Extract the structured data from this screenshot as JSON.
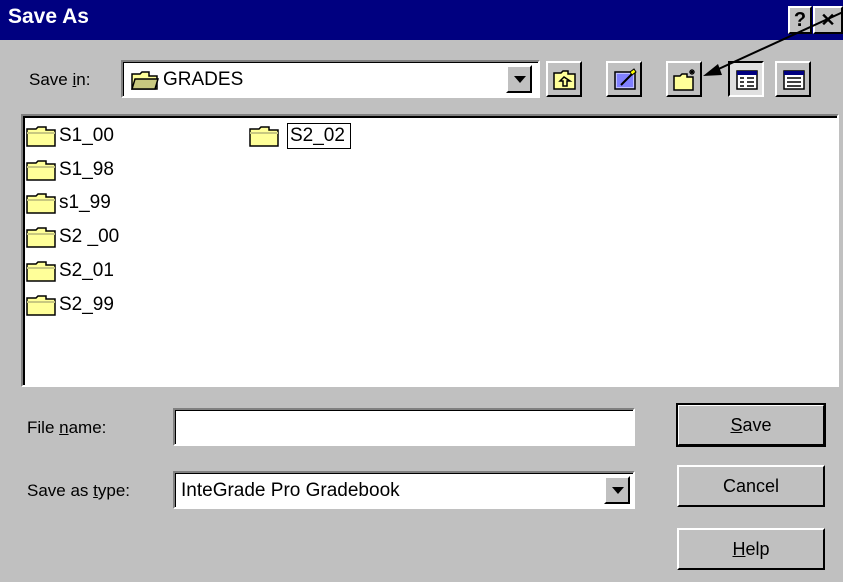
{
  "window": {
    "title": "Save As",
    "help_glyph": "?",
    "close_glyph": "✕"
  },
  "save_in": {
    "label_pre": "Save ",
    "label_underline": "i",
    "label_post": "n:",
    "current_folder": "GRADES"
  },
  "toolbar": {
    "buttons": [
      {
        "icon": "up-one-level-icon"
      },
      {
        "icon": "go-to-favorites-icon"
      },
      {
        "icon": "create-new-folder-icon"
      },
      {
        "icon": "list-view-icon"
      },
      {
        "icon": "details-view-icon"
      }
    ]
  },
  "files": [
    {
      "name": "S1_00"
    },
    {
      "name": "S1_98"
    },
    {
      "name": "s1_99"
    },
    {
      "name": "S2 _00"
    },
    {
      "name": "S2_01"
    },
    {
      "name": "S2_99"
    },
    {
      "name": "S2_02",
      "editing": true
    }
  ],
  "filename": {
    "label_pre": "File ",
    "label_underline": "n",
    "label_post": "ame:",
    "value": ""
  },
  "filetype": {
    "label_pre": "Save as ",
    "label_underline": "t",
    "label_post": "ype:",
    "value": "InteGrade Pro Gradebook"
  },
  "buttons": {
    "save_underline": "S",
    "save_rest": "ave",
    "cancel": "Cancel",
    "help_underline": "H",
    "help_rest": "elp"
  },
  "colors": {
    "titlebar": "#000080",
    "face": "#c0c0c0",
    "folder": "#ffff99"
  }
}
